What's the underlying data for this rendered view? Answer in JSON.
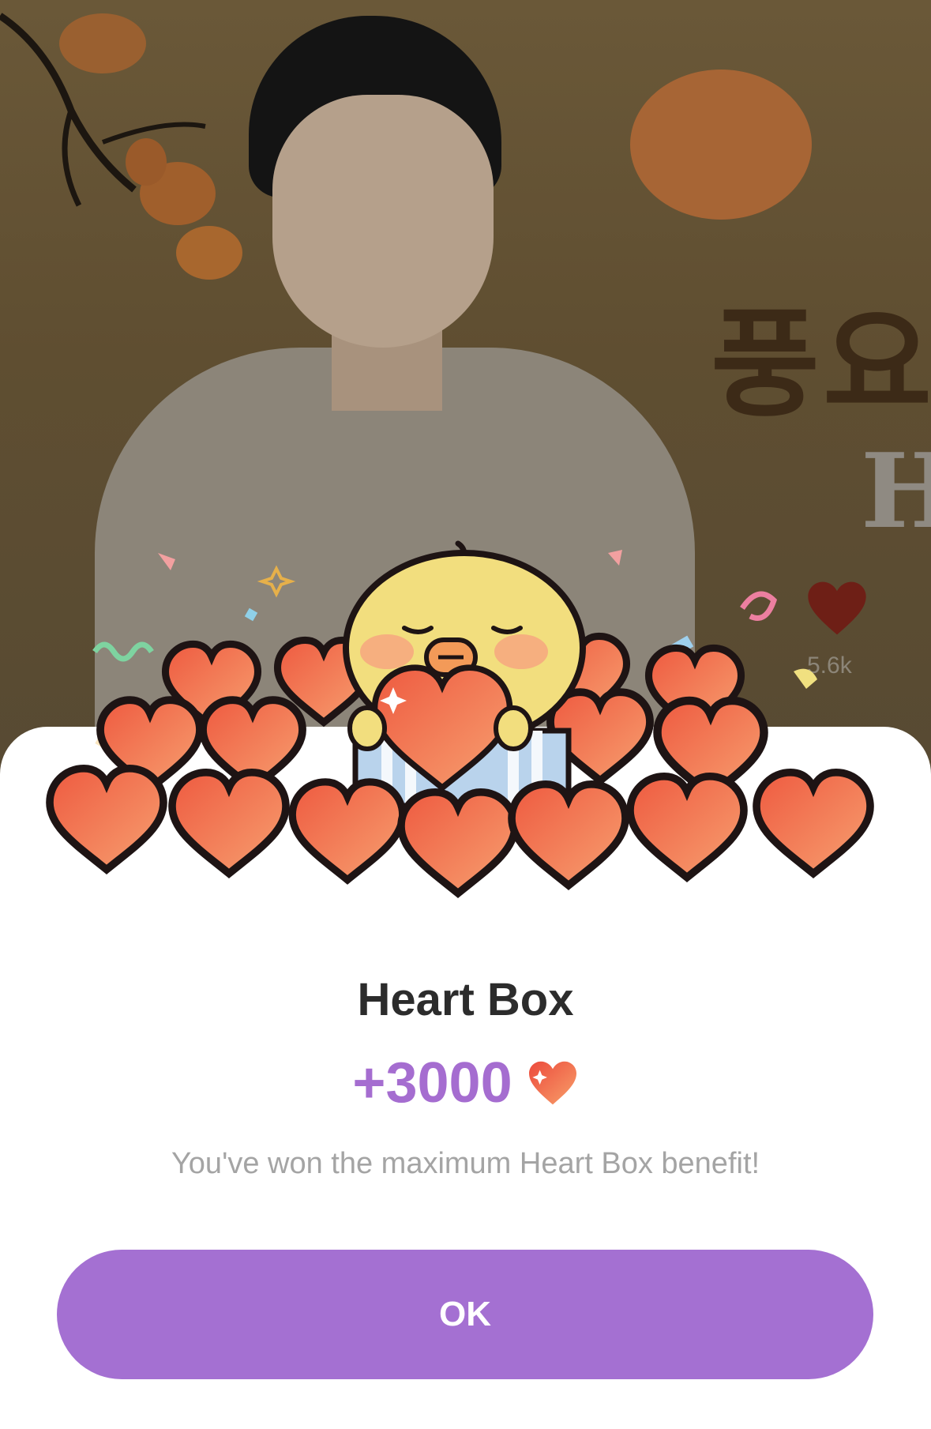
{
  "background": {
    "korean_text": "풍요",
    "latin_letter": "H",
    "like_count": "5.6k"
  },
  "modal": {
    "title": "Heart Box",
    "reward_amount": "+3000",
    "message": "You've won the maximum Heart Box benefit!",
    "ok_label": "OK"
  },
  "colors": {
    "accent": "#a470d2",
    "reward_text": "#a56dd0",
    "heart": "#ef6a48"
  },
  "icons": {
    "reward_icon": "heart-icon",
    "like_icon": "heart-icon"
  }
}
